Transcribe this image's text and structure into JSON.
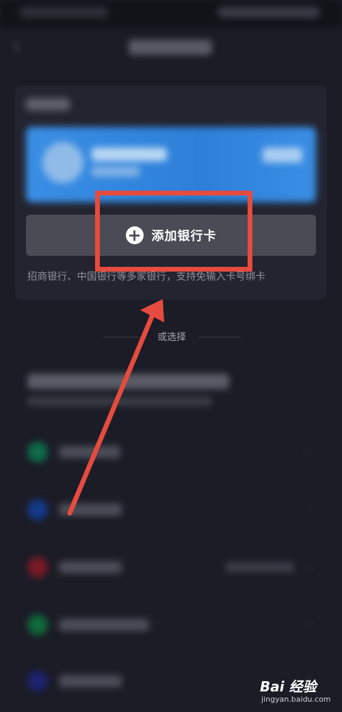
{
  "add_card": {
    "label": "添加银行卡"
  },
  "support_text": "招商银行、中国银行等多家银行，支持免输入卡号绑卡",
  "divider": {
    "label": "或选择"
  },
  "bank_rows": [
    {
      "logo_color": "#0f6b4a",
      "name_width": 90,
      "has_extra": false
    },
    {
      "logo_color": "#143a8a",
      "name_width": 92,
      "has_extra": false
    },
    {
      "logo_color": "#7a1a26",
      "name_width": 92,
      "has_extra": true
    },
    {
      "logo_color": "#106a3a",
      "name_width": 132,
      "has_extra": false
    },
    {
      "logo_color": "#1c2370",
      "name_width": 92,
      "has_extra": false
    }
  ],
  "annotation": {
    "color": "#e54b3e"
  },
  "watermark": {
    "logo": "Bai 经验",
    "url": "jingyan.baidu.com"
  }
}
